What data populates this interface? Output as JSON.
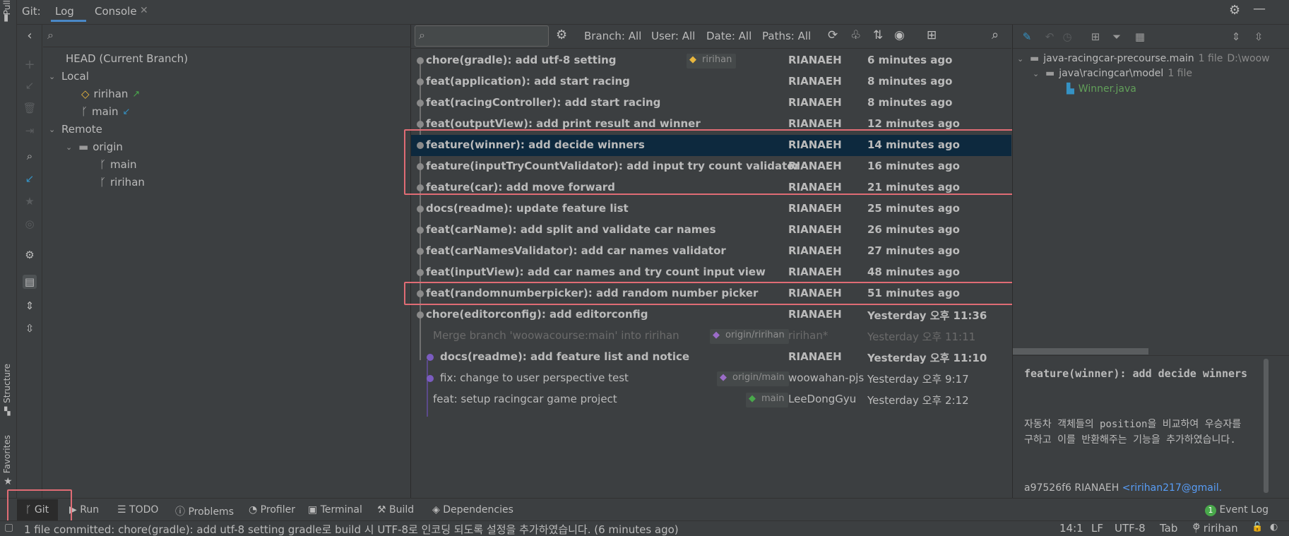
{
  "stripe": {
    "pull": "Pull",
    "structure": "Structure",
    "favorites": "Favorites"
  },
  "header": {
    "prefix": "Git:",
    "tabs": [
      {
        "label": "Log"
      },
      {
        "label": "Console"
      }
    ]
  },
  "branches": {
    "head": "HEAD (Current Branch)",
    "local": "Local",
    "local_items": [
      "ririhan",
      "main"
    ],
    "remote": "Remote",
    "origin": "origin",
    "origin_items": [
      "main",
      "ririhan"
    ]
  },
  "log_toolbar": {
    "search_placeholder": "",
    "branch": "Branch: All",
    "user": "User: All",
    "date": "Date: All",
    "paths": "Paths: All"
  },
  "commits": [
    {
      "subject": "chore(gradle): add utf-8 setting",
      "ref": "ririhan",
      "author": "RIANAEH",
      "date": "6 minutes ago"
    },
    {
      "subject": "feat(application): add start racing",
      "author": "RIANAEH",
      "date": "8 minutes ago"
    },
    {
      "subject": "feat(racingController): add start racing",
      "author": "RIANAEH",
      "date": "8 minutes ago"
    },
    {
      "subject": "feat(outputView): add print result and winner",
      "author": "RIANAEH",
      "date": "12 minutes ago"
    },
    {
      "subject": "feature(winner): add decide winners",
      "author": "RIANAEH",
      "date": "14 minutes ago"
    },
    {
      "subject": "feature(inputTryCountValidator): add input try count validator",
      "author": "RIANAEH",
      "date": "16 minutes ago"
    },
    {
      "subject": "feature(car): add move forward",
      "author": "RIANAEH",
      "date": "21 minutes ago"
    },
    {
      "subject": "docs(readme): update feature list",
      "author": "RIANAEH",
      "date": "25 minutes ago"
    },
    {
      "subject": "feat(carName): add split and validate car names",
      "author": "RIANAEH",
      "date": "26 minutes ago"
    },
    {
      "subject": "feat(carNamesValidator): add car names validator",
      "author": "RIANAEH",
      "date": "27 minutes ago"
    },
    {
      "subject": "feat(inputView): add car names and try count input view",
      "author": "RIANAEH",
      "date": "48 minutes ago"
    },
    {
      "subject": "feat(randomnumberpicker): add random number picker",
      "author": "RIANAEH",
      "date": "51 minutes ago"
    },
    {
      "subject": "chore(editorconfig): add editorconfig",
      "author": "RIANAEH",
      "date": "Yesterday 오후 11:36"
    },
    {
      "subject": "Merge branch 'woowacourse:main' into ririhan",
      "ref": "origin/ririhan",
      "author": "ririhan*",
      "date": "Yesterday 오후 11:11"
    },
    {
      "subject": "docs(readme): add feature list and notice",
      "author": "RIANAEH",
      "date": "Yesterday 오후 11:10"
    },
    {
      "subject": "fix: change to user perspective test",
      "ref": "origin/main",
      "author": "woowahan-pjs",
      "date": "Yesterday 오후 9:17"
    },
    {
      "subject": "feat: setup racingcar game project",
      "ref": "main",
      "author": "LeeDongGyu",
      "date": "Yesterday 오후 2:12"
    }
  ],
  "changes": {
    "root": "java-racingcar-precourse.main",
    "root_count": "1 file",
    "root_path": "D:\\woow",
    "folder": "java\\racingcar\\model",
    "folder_count": "1 file",
    "file": "Winner.java"
  },
  "detail": {
    "title": "feature(winner): add decide winners",
    "body": "자동차 객체들의 position을 비교하여 우승자를 구하고 이를 반환해주는 기능을 추가하였습니다.",
    "hash": "a97526f6",
    "author": "RIANAEH",
    "email": "<ririhan217@gmail."
  },
  "bottom_tabs": [
    "Git",
    "Run",
    "TODO",
    "Problems",
    "Profiler",
    "Terminal",
    "Build",
    "Dependencies"
  ],
  "event_log": {
    "count": "1",
    "label": "Event Log"
  },
  "status": {
    "message": "1 file committed: chore(gradle): add utf-8 setting gradle로 build 시 UTF-8로 인코딩 되도록 설정을 추가하였습니다. (6 minutes ago)",
    "position": "14:1",
    "line_sep": "LF",
    "encoding": "UTF-8",
    "indent": "Tab",
    "branch": "ririhan"
  },
  "colors": {
    "accent": "#3592c4",
    "highlight": "#e06c75",
    "selected": "#0d293e",
    "tag": "#e8b63e",
    "green": "#49a84b",
    "purple": "#9b6cc8"
  }
}
